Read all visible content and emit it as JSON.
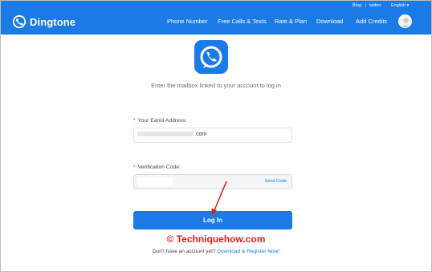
{
  "header": {
    "brand": "Dingtone",
    "nav": [
      "Phone Number",
      "Free Calls & Texts",
      "Rate & Plan",
      "Download",
      "Add Credits"
    ],
    "top_links": {
      "blog": "Blog",
      "separator": "|",
      "twitter": "twitter",
      "language": "English"
    }
  },
  "main": {
    "instruction": "Enter the mailbox linked to your account to log in",
    "email_label": "Your Eamil Address:",
    "email_value": ".com",
    "code_label": "Verification Code:",
    "send_code": "Send Code",
    "login_button": "Log In",
    "footer_text": "Don't have an account yet?",
    "footer_link": "Download & Register Now!"
  },
  "watermark": "© Techniquehow.com",
  "colors": {
    "brand_blue": "#1a7ae6",
    "required_star": "#e23b3b",
    "annotation_red": "#e21d1d"
  },
  "icons": [
    "dingtone-logo-icon",
    "dingtone-app-icon",
    "user-avatar",
    "chevron-down-icon",
    "red-arrow"
  ]
}
